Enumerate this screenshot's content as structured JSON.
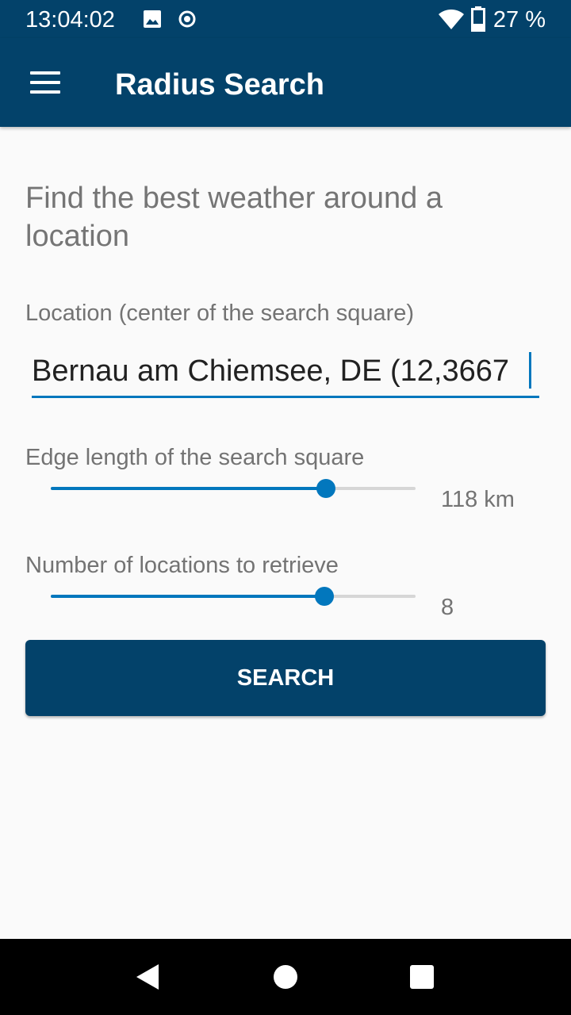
{
  "status_bar": {
    "time": "13:04:02",
    "battery": "27 %",
    "icons": [
      "image-icon",
      "record-icon",
      "wifi-icon",
      "battery-icon"
    ]
  },
  "app_bar": {
    "title": "Radius Search",
    "menu_icon": "hamburger-menu-icon"
  },
  "main": {
    "heading": "Find the best weather around a location",
    "location_label": "Location (center of the search square)",
    "location_value": "Bernau am Chiemsee, DE (12,3667",
    "edge_label": "Edge length of the search square",
    "edge_value": "118 km",
    "edge_fraction": 0.754,
    "count_label": "Number of locations to retrieve",
    "count_value": "8",
    "count_fraction": 0.75,
    "search_button": "SEARCH"
  },
  "colors": {
    "primary": "#03426a",
    "accent": "#0277bd",
    "background": "#fafafa"
  },
  "nav_bar": {
    "icons": [
      "back-icon",
      "home-icon",
      "recents-icon"
    ]
  }
}
